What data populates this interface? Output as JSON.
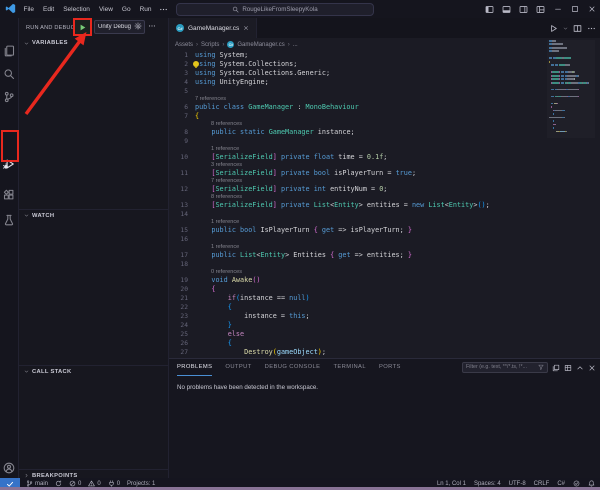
{
  "colors": {
    "accent_blue": "#3673c8",
    "annotation_red": "#e8281e",
    "play_green": "#79cc78",
    "tab_underline": "#4a8fd4"
  },
  "titlebar": {
    "menus": [
      "File",
      "Edit",
      "Selection",
      "View",
      "Go",
      "Run"
    ],
    "search": "RougeLikeFromSleepyKola",
    "window_controls": [
      "layout-sidebar",
      "layout-panel",
      "layout-secondary-sidebar",
      "layout-customize",
      "minimize",
      "maximize",
      "close"
    ]
  },
  "activity_bar": {
    "icons": [
      {
        "name": "explorer",
        "active": false
      },
      {
        "name": "search",
        "active": false
      },
      {
        "name": "source-control",
        "active": false
      },
      {
        "name": "run-and-debug",
        "active": true,
        "annotated": true
      },
      {
        "name": "extensions",
        "active": false
      },
      {
        "name": "testing",
        "active": false
      }
    ],
    "bottom_icons": [
      {
        "name": "account"
      },
      {
        "name": "settings-gear"
      }
    ]
  },
  "sidebar": {
    "title": "RUN AND DEBUG",
    "launch_config": "Unity Debug",
    "sections": [
      {
        "label": "VARIABLES",
        "collapsed": false
      },
      {
        "label": "WATCH",
        "collapsed": false
      },
      {
        "label": "CALL STACK",
        "collapsed": false
      },
      {
        "label": "BREAKPOINTS",
        "collapsed": true
      }
    ]
  },
  "editor": {
    "tab": "GameManager.cs",
    "breadcrumbs": [
      "Assets",
      "Scripts",
      "GameManager.cs",
      "..."
    ],
    "actions": [
      "run",
      "chevron-down",
      "split-editor",
      "more"
    ],
    "code_lines": [
      {
        "n": 1,
        "t": [
          [
            "using",
            "k"
          ],
          [
            " System;",
            "w"
          ]
        ]
      },
      {
        "n": 2,
        "bulb": true,
        "t": [
          [
            "using",
            "k"
          ],
          [
            " System.Collections;",
            "w"
          ]
        ]
      },
      {
        "n": 3,
        "t": [
          [
            "using",
            "k"
          ],
          [
            " System.Collections.Generic;",
            "w"
          ]
        ]
      },
      {
        "n": 4,
        "t": [
          [
            "using",
            "k"
          ],
          [
            " UnityEngine;",
            "w"
          ]
        ]
      },
      {
        "n": 5,
        "t": []
      },
      {
        "lens": "7 references",
        "ind": 0
      },
      {
        "n": 6,
        "t": [
          [
            "public",
            "k"
          ],
          [
            " ",
            "w"
          ],
          [
            "class",
            "k"
          ],
          [
            " ",
            "w"
          ],
          [
            "GameManager",
            "t"
          ],
          [
            " : ",
            "w"
          ],
          [
            "MonoBehaviour",
            "t"
          ]
        ]
      },
      {
        "n": 7,
        "t": [
          [
            "{",
            "b1"
          ]
        ]
      },
      {
        "lens": "8 references",
        "ind": 1
      },
      {
        "n": 8,
        "t": [
          [
            "    ",
            "w"
          ],
          [
            "public",
            "k"
          ],
          [
            " ",
            "w"
          ],
          [
            "static",
            "k"
          ],
          [
            " ",
            "w"
          ],
          [
            "GameManager",
            "t"
          ],
          [
            " instance;",
            "w"
          ]
        ]
      },
      {
        "n": 9,
        "t": []
      },
      {
        "lens": "1 reference",
        "ind": 1
      },
      {
        "n": 10,
        "t": [
          [
            "    ",
            "w"
          ],
          [
            "[",
            "b2"
          ],
          [
            "SerializeField",
            "t"
          ],
          [
            "]",
            "b2"
          ],
          [
            " ",
            "w"
          ],
          [
            "private",
            "k"
          ],
          [
            " ",
            "w"
          ],
          [
            "float",
            "k"
          ],
          [
            " time = ",
            "w"
          ],
          [
            "0.1f",
            "n"
          ],
          [
            ";",
            "w"
          ]
        ]
      },
      {
        "lens": "3 references",
        "ind": 1
      },
      {
        "n": 11,
        "t": [
          [
            "    ",
            "w"
          ],
          [
            "[",
            "b2"
          ],
          [
            "SerializeField",
            "t"
          ],
          [
            "]",
            "b2"
          ],
          [
            " ",
            "w"
          ],
          [
            "private",
            "k"
          ],
          [
            " ",
            "w"
          ],
          [
            "bool",
            "k"
          ],
          [
            " isPlayerTurn = ",
            "w"
          ],
          [
            "true",
            "k"
          ],
          [
            ";",
            "w"
          ]
        ]
      },
      {
        "lens": "7 references",
        "ind": 1
      },
      {
        "n": 12,
        "t": [
          [
            "    ",
            "w"
          ],
          [
            "[",
            "b2"
          ],
          [
            "SerializeField",
            "t"
          ],
          [
            "]",
            "b2"
          ],
          [
            " ",
            "w"
          ],
          [
            "private",
            "k"
          ],
          [
            " ",
            "w"
          ],
          [
            "int",
            "k"
          ],
          [
            " entityNum = ",
            "w"
          ],
          [
            "0",
            "n"
          ],
          [
            ";",
            "w"
          ]
        ]
      },
      {
        "lens": "8 references",
        "ind": 1
      },
      {
        "n": 13,
        "t": [
          [
            "    ",
            "w"
          ],
          [
            "[",
            "b2"
          ],
          [
            "SerializeField",
            "t"
          ],
          [
            "]",
            "b2"
          ],
          [
            " ",
            "w"
          ],
          [
            "private",
            "k"
          ],
          [
            " ",
            "w"
          ],
          [
            "List",
            "t"
          ],
          [
            "<",
            "w"
          ],
          [
            "Entity",
            "t"
          ],
          [
            "> entities = ",
            "w"
          ],
          [
            "new",
            "k"
          ],
          [
            " ",
            "w"
          ],
          [
            "List",
            "t"
          ],
          [
            "<",
            "w"
          ],
          [
            "Entity",
            "t"
          ],
          [
            ">",
            "w"
          ],
          [
            "()",
            "b3"
          ],
          [
            ";",
            "w"
          ]
        ]
      },
      {
        "n": 14,
        "t": []
      },
      {
        "lens": "1 reference",
        "ind": 1
      },
      {
        "n": 15,
        "t": [
          [
            "    ",
            "w"
          ],
          [
            "public",
            "k"
          ],
          [
            " ",
            "w"
          ],
          [
            "bool",
            "k"
          ],
          [
            " IsPlayerTurn ",
            "w"
          ],
          [
            "{",
            "b2"
          ],
          [
            " ",
            "w"
          ],
          [
            "get",
            "k"
          ],
          [
            " => isPlayerTurn; ",
            "w"
          ],
          [
            "}",
            "b2"
          ]
        ]
      },
      {
        "n": 16,
        "t": []
      },
      {
        "lens": "1 reference",
        "ind": 1
      },
      {
        "n": 17,
        "t": [
          [
            "    ",
            "w"
          ],
          [
            "public",
            "k"
          ],
          [
            " ",
            "w"
          ],
          [
            "List",
            "t"
          ],
          [
            "<",
            "w"
          ],
          [
            "Entity",
            "t"
          ],
          [
            "> Entities ",
            "w"
          ],
          [
            "{",
            "b2"
          ],
          [
            " ",
            "w"
          ],
          [
            "get",
            "k"
          ],
          [
            " => entities; ",
            "w"
          ],
          [
            "}",
            "b2"
          ]
        ]
      },
      {
        "n": 18,
        "t": []
      },
      {
        "lens": "0 references",
        "ind": 1
      },
      {
        "n": 19,
        "t": [
          [
            "    ",
            "w"
          ],
          [
            "void",
            "k"
          ],
          [
            " ",
            "w"
          ],
          [
            "Awake",
            "f"
          ],
          [
            "()",
            "b2"
          ]
        ]
      },
      {
        "n": 20,
        "t": [
          [
            "    ",
            "w"
          ],
          [
            "{",
            "b2"
          ]
        ]
      },
      {
        "n": 21,
        "t": [
          [
            "        ",
            "w"
          ],
          [
            "if",
            "c"
          ],
          [
            "(",
            "b3"
          ],
          [
            "instance == ",
            "w"
          ],
          [
            "null",
            "k"
          ],
          [
            ")",
            "b3"
          ]
        ]
      },
      {
        "n": 22,
        "t": [
          [
            "        ",
            "w"
          ],
          [
            "{",
            "b3"
          ]
        ]
      },
      {
        "n": 23,
        "t": [
          [
            "            instance = ",
            "w"
          ],
          [
            "this",
            "k"
          ],
          [
            ";",
            "w"
          ]
        ]
      },
      {
        "n": 24,
        "t": [
          [
            "        ",
            "w"
          ],
          [
            "}",
            "b3"
          ]
        ]
      },
      {
        "n": 25,
        "t": [
          [
            "        ",
            "w"
          ],
          [
            "else",
            "c"
          ]
        ]
      },
      {
        "n": 26,
        "t": [
          [
            "        ",
            "w"
          ],
          [
            "{",
            "b3"
          ]
        ]
      },
      {
        "n": 27,
        "t": [
          [
            "            ",
            "w"
          ],
          [
            "Destroy",
            "f"
          ],
          [
            "(",
            "b1"
          ],
          [
            "gameObject",
            "v"
          ],
          [
            ")",
            "b1"
          ],
          [
            ";",
            "w"
          ]
        ]
      }
    ]
  },
  "panel": {
    "tabs": [
      "PROBLEMS",
      "OUTPUT",
      "DEBUG CONSOLE",
      "TERMINAL",
      "PORTS"
    ],
    "active_tab": "PROBLEMS",
    "filter_placeholder": "Filter (e.g. text, **/*.ts, !*...",
    "icons": [
      "copy",
      "table",
      "chevron-up",
      "close"
    ],
    "message": "No problems have been detected in the workspace."
  },
  "status_bar": {
    "remote_icon": "check",
    "left": [
      {
        "icon": "branch",
        "label": "main"
      },
      {
        "icon": "sync",
        "label": ""
      },
      {
        "icon": "error",
        "label": "0"
      },
      {
        "icon": "warning",
        "label": "0"
      },
      {
        "icon": "plug",
        "label": "0"
      },
      {
        "icon": "",
        "label": "Projects: 1"
      }
    ],
    "right": [
      {
        "icon": "",
        "label": "Ln 1, Col 1"
      },
      {
        "icon": "",
        "label": "Spaces: 4"
      },
      {
        "icon": "",
        "label": "UTF-8"
      },
      {
        "icon": "",
        "label": "CRLF"
      },
      {
        "icon": "",
        "label": "C#"
      },
      {
        "icon": "check-circle",
        "label": ""
      },
      {
        "icon": "bell",
        "label": ""
      }
    ]
  }
}
